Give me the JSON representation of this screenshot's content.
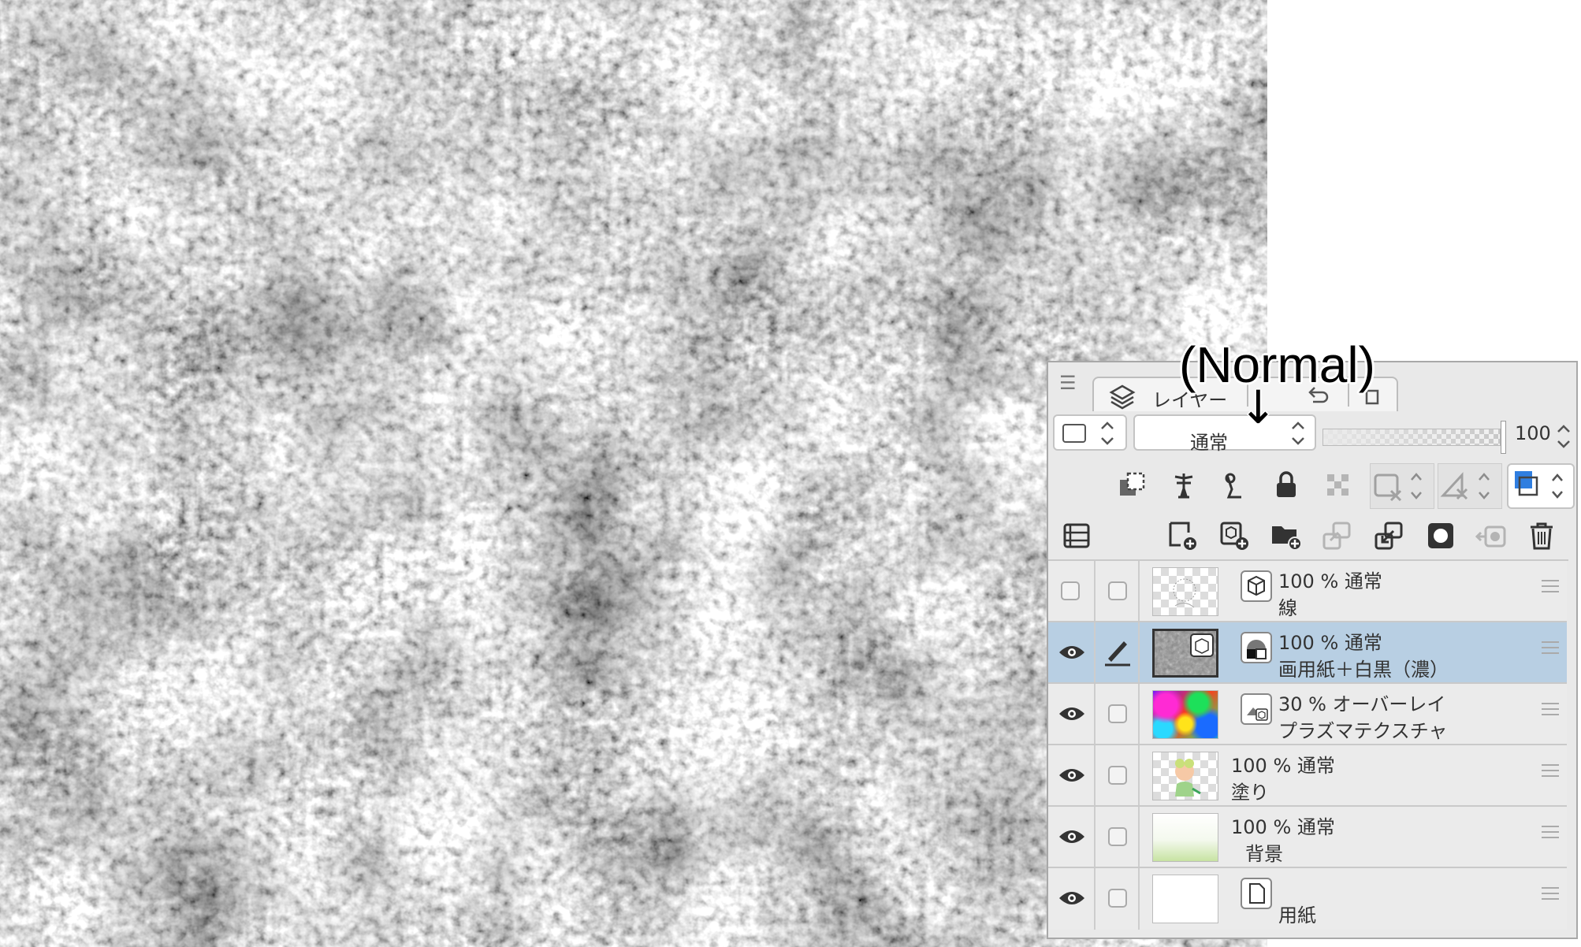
{
  "panel": {
    "menu_icon": "hamburger-icon",
    "tab_label": "レイヤー",
    "tab_icon": "layers-icon"
  },
  "toolbar": {
    "blend_mode": "通常",
    "opacity": 100
  },
  "layers": [
    {
      "opacity": "100 %",
      "mode": "通常",
      "name": "線",
      "visible": false,
      "selected": false
    },
    {
      "opacity": "100 %",
      "mode": "通常",
      "name": "画用紙＋白黒（濃）",
      "visible": true,
      "selected": true
    },
    {
      "opacity": "30 %",
      "mode": "オーバーレイ",
      "name": "プラズマテクスチャ",
      "visible": true,
      "selected": false
    },
    {
      "opacity": "100 %",
      "mode": "通常",
      "name": "塗り",
      "visible": true,
      "selected": false
    },
    {
      "opacity": "100 %",
      "mode": "通常",
      "name": "背景",
      "visible": true,
      "selected": false
    },
    {
      "opacity": "",
      "mode": "",
      "name": "用紙",
      "visible": true,
      "selected": false
    }
  ],
  "annotation": {
    "label": "(Normal)",
    "arrow": "↓"
  },
  "colors": {
    "selected_row": "#b8cfe3",
    "color_swatch": "#2f7ee0"
  }
}
